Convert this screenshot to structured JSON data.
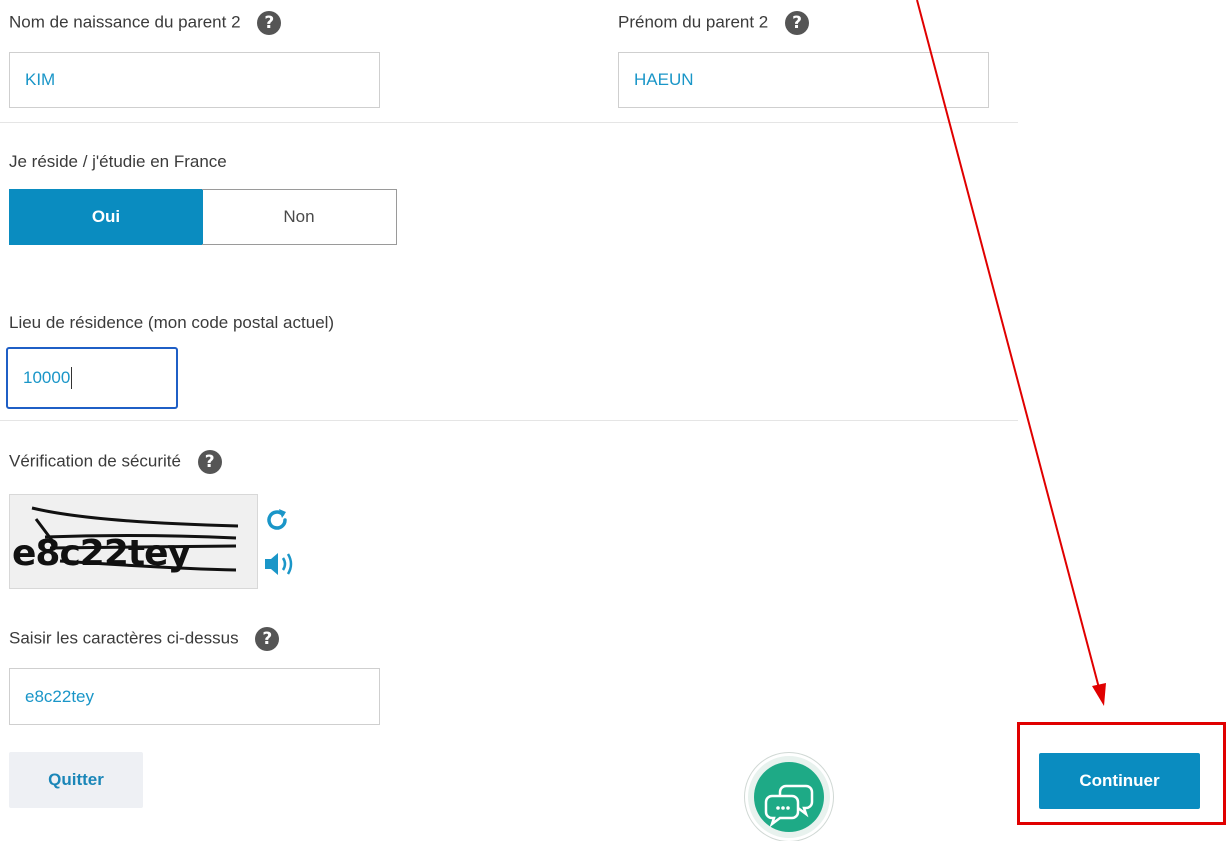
{
  "parent2": {
    "last_name_label": "Nom de naissance du parent 2",
    "last_name_value": "KIM",
    "first_name_label": "Prénom du parent 2",
    "first_name_value": "HAEUN",
    "help_glyph": "?"
  },
  "residence": {
    "question_label": "Je réside / j'étudie en France",
    "yes_label": "Oui",
    "no_label": "Non",
    "selected": "Oui",
    "postal_label": "Lieu de résidence (mon code postal actuel)",
    "postal_value": "10000"
  },
  "security": {
    "label": "Vérification de sécurité",
    "captcha_text": "e8c22tey",
    "refresh_icon": "refresh-icon",
    "audio_icon": "speaker-icon",
    "input_label": "Saisir les caractères ci-dessus",
    "input_value": "e8c22tey"
  },
  "actions": {
    "quit_label": "Quitter",
    "continue_label": "Continuer",
    "chat_icon": "chat-icon"
  },
  "colors": {
    "accent": "#0a8cc0",
    "annotation": "#e00000"
  }
}
